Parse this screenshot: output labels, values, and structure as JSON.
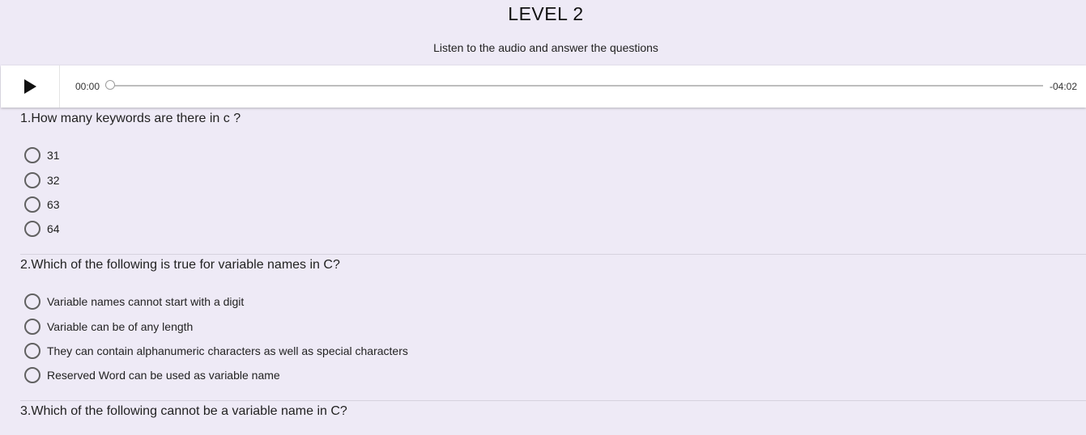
{
  "level_title": "LEVEL 2",
  "instructions": "Listen to the audio and answer the questions",
  "player": {
    "play_icon": "play-icon",
    "current_time": "00:00",
    "remaining_time": "-04:02",
    "progress": 0
  },
  "questions": [
    {
      "text": "1.How many keywords are there in c ?",
      "options": [
        "31",
        "32",
        "63",
        "64"
      ]
    },
    {
      "text": "2.Which of the following is true for variable names in C?",
      "options": [
        "Variable names cannot start with a digit",
        "Variable can be of any length",
        "They can contain alphanumeric characters as well as special characters",
        "Reserved Word can be used as variable name"
      ]
    },
    {
      "text": "3.Which of the following cannot be a variable name in C?",
      "options": []
    }
  ]
}
